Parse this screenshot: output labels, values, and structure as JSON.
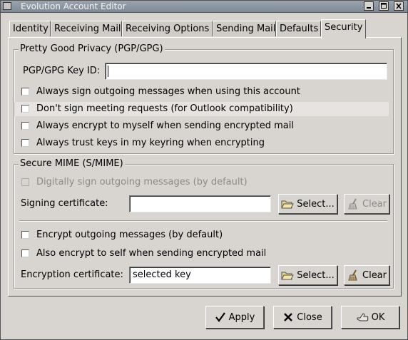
{
  "window": {
    "title": "Evolution Account Editor"
  },
  "tabs": [
    {
      "label": "Identity"
    },
    {
      "label": "Receiving Mail"
    },
    {
      "label": "Receiving Options"
    },
    {
      "label": "Sending Mail"
    },
    {
      "label": "Defaults"
    },
    {
      "label": "Security"
    }
  ],
  "active_tab": "Security",
  "pgp": {
    "frame_title": "Pretty Good Privacy (PGP/GPG)",
    "key_id_label": "PGP/GPG Key ID:",
    "key_id_value": "",
    "options": [
      {
        "label": "Always sign outgoing messages when using this account",
        "checked": false
      },
      {
        "label": "Don't sign meeting requests (for Outlook compatibility)",
        "checked": false
      },
      {
        "label": "Always encrypt to myself when sending encrypted mail",
        "checked": false
      },
      {
        "label": "Always trust keys in my keyring when encrypting",
        "checked": false
      }
    ]
  },
  "smime": {
    "frame_title": "Secure MIME (S/MIME)",
    "digitally_sign_label": "Digitally sign outgoing messages (by default)",
    "signing_cert_label": "Signing certificate:",
    "signing_cert_value": "",
    "select_label": "Select...",
    "clear_label": "Clear",
    "encrypt_outgoing_label": "Encrypt outgoing messages (by default)",
    "encrypt_self_label": "Also encrypt to self when sending encrypted mail",
    "encryption_cert_label": "Encryption certificate:",
    "encryption_cert_value": "selected key"
  },
  "footer": {
    "apply_label": "Apply",
    "close_label": "Close",
    "ok_label": "OK"
  }
}
